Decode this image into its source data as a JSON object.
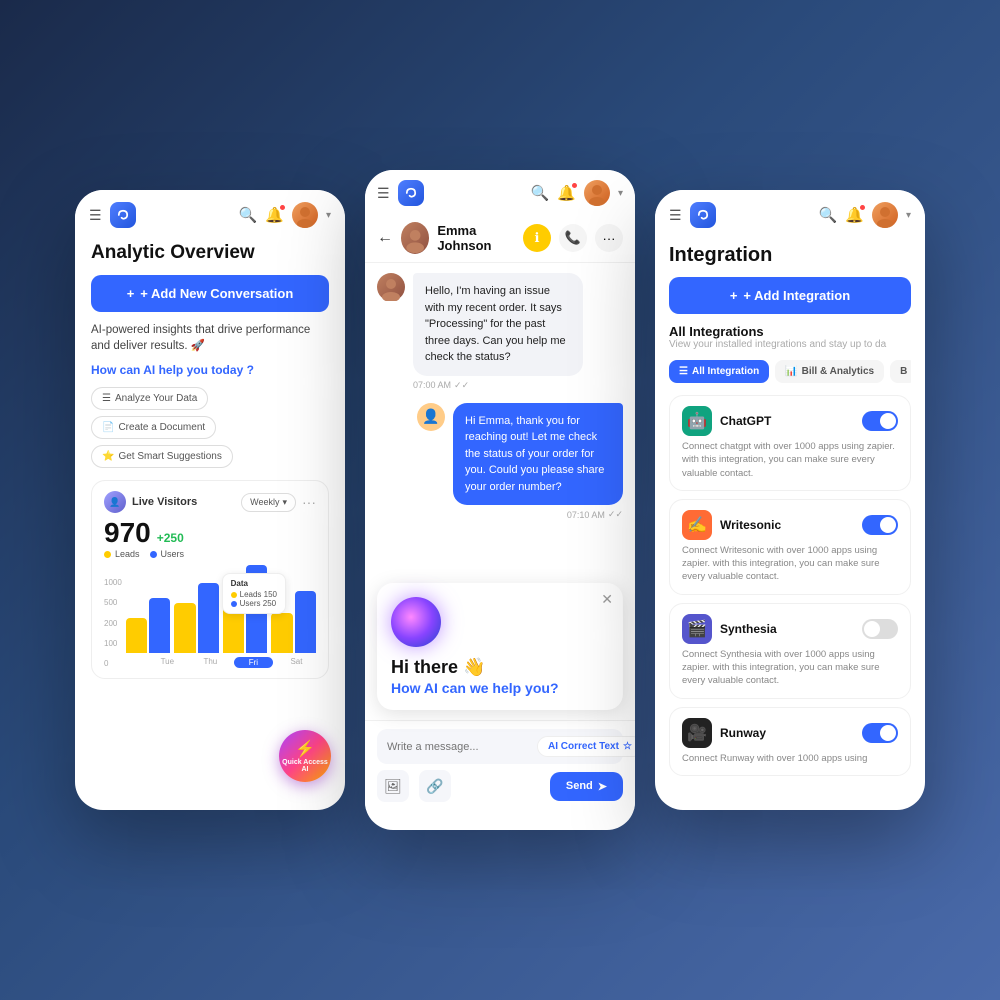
{
  "background": "#1a2a6c",
  "left_phone": {
    "page_title": "Analytic Overview",
    "add_btn_label": "+ Add New Conversation",
    "ai_text": "AI-powered insights that drive performance and deliver results. 🚀",
    "ai_question": "How can AI help you today ?",
    "chips": [
      {
        "icon": "☰",
        "label": "Analyze Your Data"
      },
      {
        "icon": "📄",
        "label": "Create a Document"
      },
      {
        "icon": "⭐",
        "label": "Get Smart Suggestions"
      }
    ],
    "live_visitors": {
      "title": "Live Visitors",
      "filter": "Weekly",
      "number": "970",
      "plus": "+250",
      "legend_leads": "Leads",
      "legend_users": "Users"
    },
    "chart": {
      "y_labels": [
        "1000",
        "500",
        "200",
        "100",
        "0"
      ],
      "x_labels": [
        "Tue",
        "Thu",
        "Fri",
        "Sat"
      ],
      "active_x": "Fri",
      "bars": [
        {
          "leads_h": 35,
          "users_h": 55
        },
        {
          "leads_h": 50,
          "users_h": 70
        },
        {
          "leads_h": 85,
          "users_h": 90
        },
        {
          "leads_h": 40,
          "users_h": 60
        }
      ],
      "tooltip": {
        "title": "Data",
        "leads": "Leads 150",
        "users": "Users 250"
      }
    },
    "quick_access_label": "Quick Access AI"
  },
  "center_phone": {
    "chat_name": "Emma Johnson",
    "msg_incoming": "Hello, I'm having an issue with my recent order. It says \"Processing\" for the past three days. Can you help me check the status?",
    "msg_time1": "07:00 AM",
    "msg_outgoing": "Hi Emma, thank you for reaching out! Let me check the status of your order for you. Could you please share your order number?",
    "msg_time2": "07:10 AM",
    "ai_greeting": "Hi there 👋",
    "ai_subtext": "How AI can we help you?",
    "input_placeholder": "Write a message...",
    "ai_correct_label": "AI Correct Text",
    "ai_correct_star": "☆",
    "send_label": "Send"
  },
  "right_phone": {
    "page_title": "Integration",
    "add_btn_label": "+ Add Integration",
    "section_title": "All Integrations",
    "section_sub": "View your installed integrations and stay up to da",
    "tabs": [
      {
        "label": "All Integration",
        "active": true,
        "icon": "☰"
      },
      {
        "label": "Bill & Analytics",
        "active": false,
        "icon": "📊"
      },
      {
        "label": "B",
        "active": false,
        "icon": ""
      }
    ],
    "integrations": [
      {
        "name": "ChatGPT",
        "logo_emoji": "🤖",
        "logo_class": "gpt",
        "desc": "Connect chatgpt with over 1000 apps using zapier. with this integration, you can make sure every valuable contact.",
        "enabled": true
      },
      {
        "name": "Writesonic",
        "logo_emoji": "✍️",
        "logo_class": "ws",
        "desc": "Connect Writesonic with over 1000 apps using zapier. with this integration, you can make sure every valuable contact.",
        "enabled": true
      },
      {
        "name": "Synthesia",
        "logo_emoji": "🎬",
        "logo_class": "syn",
        "desc": "Connect Synthesia with over 1000 apps using zapier. with this integration, you can make sure every valuable contact.",
        "enabled": false
      },
      {
        "name": "Runway",
        "logo_emoji": "🎥",
        "logo_class": "run",
        "desc": "Connect Runway with over 1000 apps using",
        "enabled": true
      }
    ]
  },
  "colors": {
    "blue": "#3366ff",
    "leads_yellow": "#ffcc00",
    "users_blue": "#3366ff",
    "green": "#22bb55"
  }
}
